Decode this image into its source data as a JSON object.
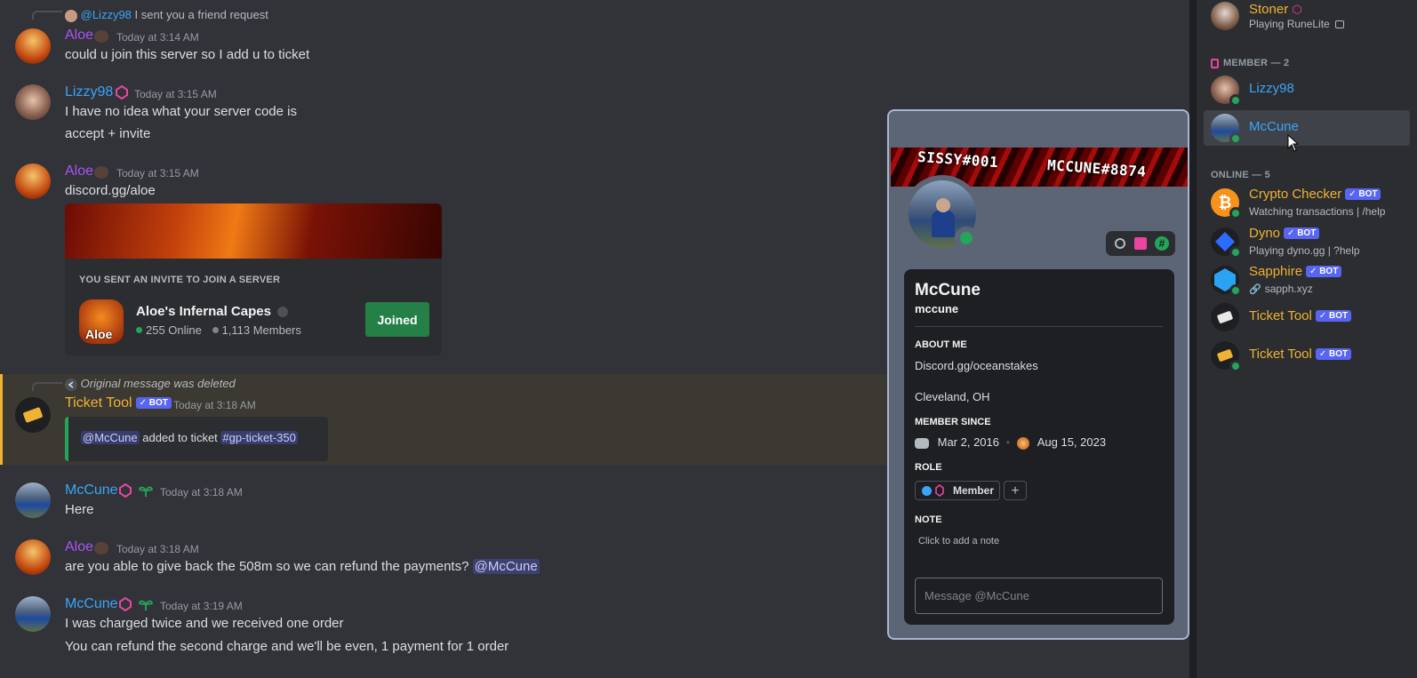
{
  "colors": {
    "aloe": "#a855f7",
    "member_blue": "#3ba4f9",
    "bot_gold": "#f0b232",
    "online": "#23a55a",
    "bot_badge": "#5865f2"
  },
  "messages": {
    "m0": {
      "reply": {
        "mention": "@Lizzy98",
        "text": "I sent you a friend request"
      },
      "author": "Aloe",
      "time": "Today at 3:14 AM",
      "lines": [
        "could u join this server so I add u to ticket"
      ]
    },
    "m1": {
      "author": "Lizzy98",
      "time": "Today at 3:15 AM",
      "lines": [
        "I have no idea what your server code is",
        "accept + invite"
      ]
    },
    "m2": {
      "author": "Aloe",
      "time": "Today at 3:15 AM",
      "lines": [
        "discord.gg/aloe"
      ],
      "invite": {
        "heading": "YOU SENT AN INVITE TO JOIN A SERVER",
        "icon_text": "Aloe",
        "server_name": "Aloe's Infernal Capes",
        "online": "255 Online",
        "members": "1,113 Members",
        "button": "Joined"
      }
    },
    "m3": {
      "reply_text": "Original message was deleted",
      "author": "Ticket Tool",
      "bot_label": "✓ BOT",
      "time": "Today at 3:18 AM",
      "embed": {
        "mention": "@McCune",
        "middle": "added to ticket",
        "channel": "#gp-ticket-350"
      }
    },
    "m4": {
      "author": "McCune",
      "time": "Today at 3:18 AM",
      "lines": [
        "Here"
      ]
    },
    "m5": {
      "author": "Aloe",
      "time": "Today at 3:18 AM",
      "text": "are you able to give back the 508m so we can refund the payments?",
      "mention": "@McCune"
    },
    "m6": {
      "author": "McCune",
      "time": "Today at 3:19 AM",
      "lines": [
        "I was charged twice and we received one order",
        "You can refund the second charge and we'll be even, 1 payment for 1 order"
      ]
    }
  },
  "popout": {
    "banner_text": [
      "SISSY#001",
      "MCCUNE#8874"
    ],
    "display_name": "McCune",
    "username": "mccune",
    "about_heading": "ABOUT ME",
    "about_lines": [
      "Discord.gg/oceanstakes",
      "Cleveland, OH"
    ],
    "member_since_heading": "MEMBER SINCE",
    "discord_since": "Mar 2, 2016",
    "server_since": "Aug 15, 2023",
    "role_heading": "ROLE",
    "role_name": "Member",
    "add_role": "+",
    "note_heading": "NOTE",
    "note_placeholder": "Click to add a note",
    "message_placeholder": "Message @McCune"
  },
  "members": {
    "stoner": {
      "name": "Stoner",
      "activity": "Playing RuneLite"
    },
    "member_heading": "MEMBER — 2",
    "member_list": [
      {
        "name": "Lizzy98"
      },
      {
        "name": "McCune"
      }
    ],
    "online_heading": "ONLINE — 5",
    "online_list": [
      {
        "name": "Crypto Checker",
        "bot": "✓ BOT",
        "activity": "Watching transactions | /help"
      },
      {
        "name": "Dyno",
        "bot": "✓ BOT",
        "activity": "Playing dyno.gg | ?help"
      },
      {
        "name": "Sapphire",
        "bot": "✓ BOT",
        "activity": "sapph.xyz"
      },
      {
        "name": "Ticket Tool",
        "bot": "✓ BOT",
        "activity": ""
      },
      {
        "name": "Ticket Tool",
        "bot": "✓ BOT",
        "activity": ""
      }
    ]
  }
}
